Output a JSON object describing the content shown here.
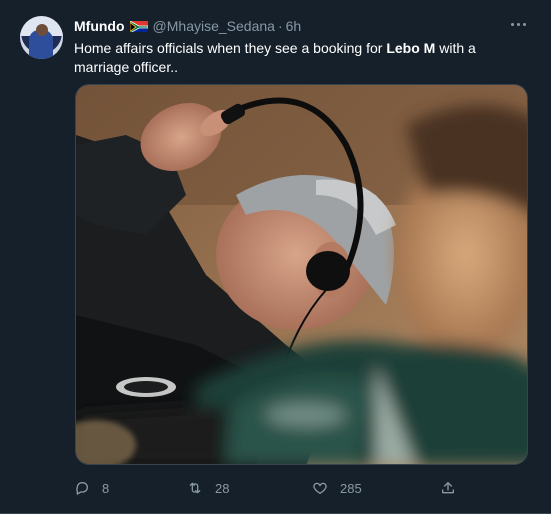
{
  "tweet": {
    "author_name": "Mfundo",
    "handle": "@Mhayise_Sedana",
    "separator": "·",
    "time": "6h",
    "text_part1": "Home affairs officials when they see a booking for ",
    "text_bold": "Lebo M",
    "text_part2": " with a marriage officer..",
    "flag_icon": "south-africa-flag-icon"
  },
  "actions": {
    "reply_count": "8",
    "retweet_count": "28",
    "like_count": "285"
  },
  "colors": {
    "background": "#15202b",
    "secondary_text": "#8899a6",
    "primary_text": "#ffffff"
  }
}
